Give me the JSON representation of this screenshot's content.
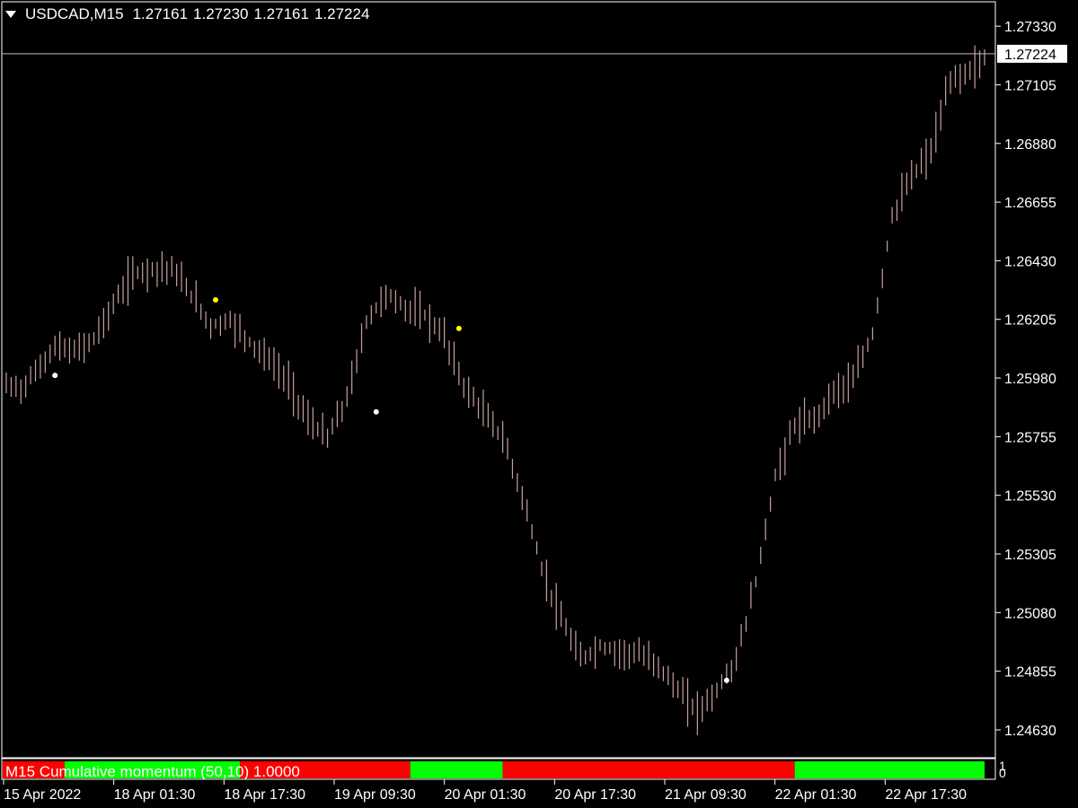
{
  "header": {
    "symbol": "USDCAD,M15",
    "open": "1.27161",
    "high": "1.27230",
    "low": "1.27161",
    "close": "1.27224"
  },
  "current_price_label": "1.27224",
  "indicator": {
    "label": "M15 Cumulative momentum (50,10) 1.0000",
    "axis_top": "1",
    "axis_bottom": "0",
    "colors": {
      "up": "#00ff00",
      "down": "#ff0000"
    }
  },
  "colors": {
    "background": "#000000",
    "axis": "#ffffff",
    "candle": "#c8a0a0",
    "dot_white": "#ffffff",
    "dot_yellow": "#ffff00"
  },
  "chart_data": {
    "type": "bar",
    "title": "USDCAD,M15",
    "y_ticks": [
      "1.27330",
      "1.27105",
      "1.26880",
      "1.26655",
      "1.26430",
      "1.26205",
      "1.25980",
      "1.25755",
      "1.25530",
      "1.25305",
      "1.25080",
      "1.24855",
      "1.24630"
    ],
    "ylim": [
      1.2453,
      1.2742
    ],
    "x_ticks": [
      "15 Apr 2022",
      "18 Apr 01:30",
      "18 Apr 17:30",
      "19 Apr 09:30",
      "20 Apr 01:30",
      "20 Apr 17:30",
      "21 Apr 09:30",
      "22 Apr 01:30",
      "22 Apr 17:30"
    ],
    "price_path": [
      [
        0,
        1.2595
      ],
      [
        3,
        1.2594
      ],
      [
        6,
        1.26
      ],
      [
        10,
        1.261
      ],
      [
        14,
        1.2608
      ],
      [
        18,
        1.2613
      ],
      [
        22,
        1.2626
      ],
      [
        26,
        1.2638
      ],
      [
        30,
        1.264
      ],
      [
        34,
        1.264
      ],
      [
        38,
        1.263
      ],
      [
        42,
        1.2618
      ],
      [
        46,
        1.262
      ],
      [
        50,
        1.2612
      ],
      [
        54,
        1.2605
      ],
      [
        58,
        1.2596
      ],
      [
        62,
        1.2582
      ],
      [
        66,
        1.2575
      ],
      [
        70,
        1.259
      ],
      [
        74,
        1.262
      ],
      [
        78,
        1.263
      ],
      [
        82,
        1.2625
      ],
      [
        86,
        1.2622
      ],
      [
        90,
        1.2614
      ],
      [
        94,
        1.2595
      ],
      [
        98,
        1.2585
      ],
      [
        102,
        1.2575
      ],
      [
        106,
        1.2553
      ],
      [
        110,
        1.2525
      ],
      [
        114,
        1.2505
      ],
      [
        118,
        1.249
      ],
      [
        122,
        1.2495
      ],
      [
        126,
        1.2493
      ],
      [
        130,
        1.2492
      ],
      [
        134,
        1.2488
      ],
      [
        138,
        1.2478
      ],
      [
        142,
        1.247
      ],
      [
        146,
        1.2478
      ],
      [
        150,
        1.249
      ],
      [
        154,
        1.252
      ],
      [
        158,
        1.256
      ],
      [
        162,
        1.258
      ],
      [
        166,
        1.2582
      ],
      [
        170,
        1.2593
      ],
      [
        174,
        1.2597
      ],
      [
        178,
        1.2615
      ],
      [
        182,
        1.266
      ],
      [
        186,
        1.2675
      ],
      [
        190,
        1.2685
      ],
      [
        194,
        1.2712
      ],
      [
        198,
        1.2716
      ],
      [
        201,
        1.272
      ]
    ],
    "signal_dots": [
      {
        "bar": 10,
        "price": 1.2599,
        "color": "white"
      },
      {
        "bar": 43,
        "price": 1.2628,
        "color": "yellow"
      },
      {
        "bar": 76,
        "price": 1.2585,
        "color": "white"
      },
      {
        "bar": 93,
        "price": 1.2617,
        "color": "yellow"
      },
      {
        "bar": 148,
        "price": 1.2482,
        "color": "white"
      }
    ],
    "momentum_segments": [
      {
        "from": "15 Apr 2022",
        "state": "down"
      },
      {
        "state": "up"
      },
      {
        "state": "down"
      },
      {
        "state": "up"
      },
      {
        "state": "down"
      },
      {
        "state": "up"
      }
    ],
    "grid": false
  }
}
